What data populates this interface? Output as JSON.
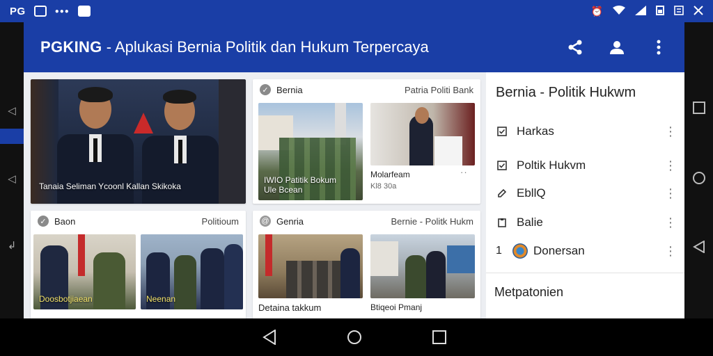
{
  "status_bar": {
    "brand": "PG",
    "time_icons": [
      "alarm-icon",
      "wifi-icon",
      "signal-icon",
      "battery-icon",
      "sim-icon",
      "close-icon"
    ]
  },
  "header": {
    "brand": "PGKING",
    "title_rest": " - Aplukasi Bernia Politik dan Hukum Terpercaya",
    "actions": [
      "share-icon",
      "account-icon",
      "more-vert-icon"
    ]
  },
  "cards": {
    "featured": {
      "caption": "Tanaia Seliman Ycoonl Kallan Skikoka"
    },
    "top_right": {
      "name": "Bernia",
      "source": "Patria Politi Bank",
      "left_caption": "IWIO Patitik Bokum",
      "left_sub": "Ule Bcean",
      "right_title": "Molarfeam",
      "right_sub": "Kl8 30a"
    },
    "bottom_left": {
      "name": "Baon",
      "source": "Politioum",
      "left_caption": "Doosbotjiaean",
      "right_caption": "Neenan"
    },
    "bottom_right": {
      "name": "Genria",
      "source": "Bernie - Politk Hukm",
      "left_title": "Detaina takkum",
      "right_title": "Btiqeoi Pmanj"
    }
  },
  "sidebar": {
    "title": "Bernia - Politik Hukwm",
    "items": [
      {
        "label": "Harkas",
        "icon": "check-box-icon"
      },
      {
        "label": "Poltik Hukvm",
        "icon": "check-box-icon"
      },
      {
        "label": "EbllQ",
        "icon": "edit-icon"
      },
      {
        "label": "Balie",
        "icon": "clipboard-icon"
      },
      {
        "label": "Donersan",
        "icon": "avatar-icon",
        "prefix": "1"
      }
    ],
    "section": "Metpatonien"
  },
  "colors": {
    "primary": "#1a3ea6",
    "background": "#eceef2"
  }
}
